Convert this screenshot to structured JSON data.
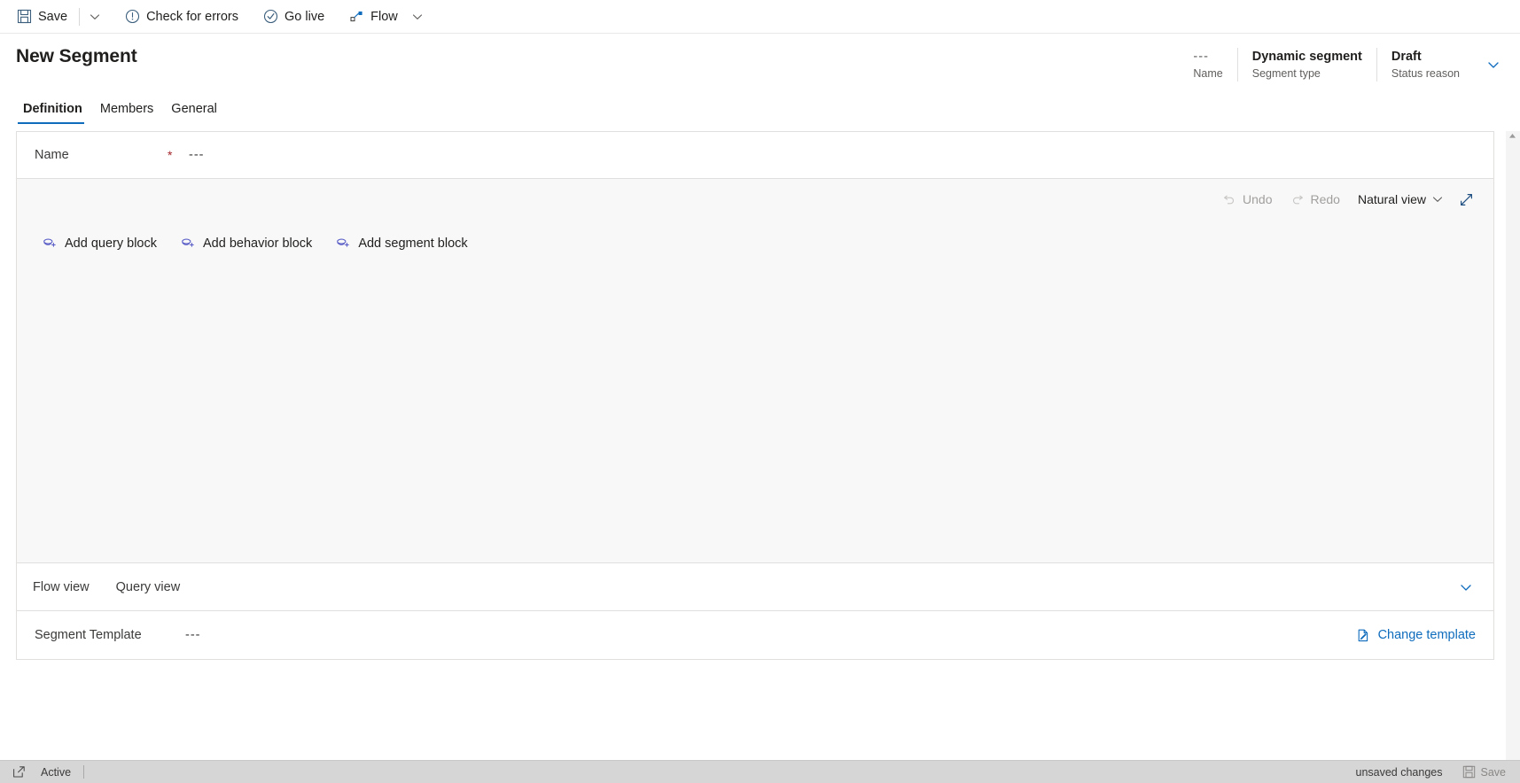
{
  "commandbar": {
    "items": [
      {
        "id": "save",
        "label": "Save",
        "icon": "save-icon"
      },
      {
        "id": "save-menu",
        "label": "",
        "icon": "chevron-down-icon"
      },
      {
        "id": "check-errors",
        "label": "Check for errors",
        "icon": "error-circle-icon"
      },
      {
        "id": "go-live",
        "label": "Go live",
        "icon": "checkmark-circle-icon"
      },
      {
        "id": "flow",
        "label": "Flow",
        "icon": "flow-icon"
      },
      {
        "id": "flow-menu",
        "label": "",
        "icon": "chevron-down-icon"
      }
    ]
  },
  "header": {
    "title": "New Segment",
    "fields": [
      {
        "value": "---",
        "label": "Name",
        "muted": true
      },
      {
        "value": "Dynamic segment",
        "label": "Segment type",
        "muted": false
      },
      {
        "value": "Draft",
        "label": "Status reason",
        "muted": false
      }
    ],
    "expand_icon": "chevron-down-icon"
  },
  "tabs": [
    {
      "label": "Definition",
      "active": true
    },
    {
      "label": "Members",
      "active": false
    },
    {
      "label": "General",
      "active": false
    }
  ],
  "form": {
    "name": {
      "label": "Name",
      "required_marker": "*",
      "value": "---"
    }
  },
  "canvas": {
    "toolbar": {
      "undo": {
        "label": "Undo",
        "icon": "undo-icon",
        "disabled": true
      },
      "redo": {
        "label": "Redo",
        "icon": "redo-icon",
        "disabled": true
      },
      "view_mode": {
        "label": "Natural view",
        "icon": "chevron-down-icon"
      },
      "expand": {
        "icon": "expand-diagonal-icon"
      }
    },
    "block_actions": [
      {
        "label": "Add query block",
        "icon": "add-block-icon"
      },
      {
        "label": "Add behavior block",
        "icon": "add-block-icon"
      },
      {
        "label": "Add segment block",
        "icon": "add-block-icon"
      }
    ]
  },
  "subtabs": [
    {
      "label": "Flow view"
    },
    {
      "label": "Query view"
    }
  ],
  "subtab_collapse_icon": "chevron-down-icon",
  "template": {
    "label": "Segment Template",
    "value": "---",
    "change": {
      "label": "Change template",
      "icon": "edit-page-icon"
    }
  },
  "statusbar": {
    "left_icon": "popout-icon",
    "state": "Active",
    "unsaved": "unsaved changes",
    "save": {
      "label": "Save",
      "icon": "save-icon"
    }
  },
  "colors": {
    "accent": "#0f6cbd",
    "required": "#a4262c",
    "canvas_bg": "#f8f8f8",
    "statusbar_bg": "#d6d6d6"
  }
}
